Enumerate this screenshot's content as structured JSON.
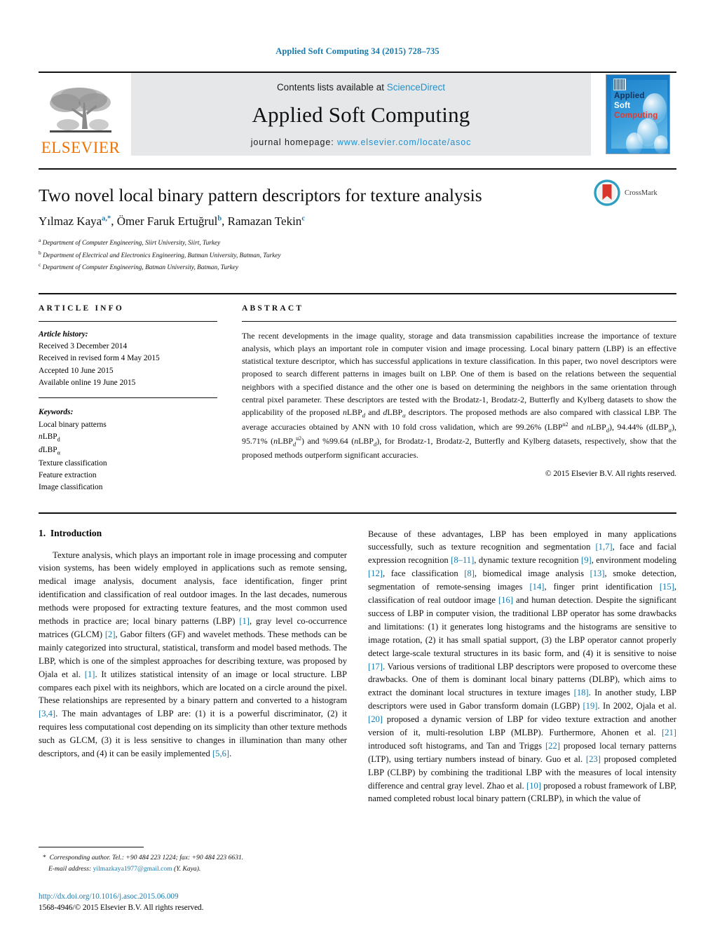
{
  "running_head": "Applied Soft Computing 34 (2015) 728–735",
  "masthead": {
    "publisher": "ELSEVIER",
    "contents_prefix": "Contents lists available at ",
    "contents_link": "ScienceDirect",
    "journal_name": "Applied Soft Computing",
    "homepage_prefix": "journal homepage: ",
    "homepage_url": "www.elsevier.com/locate/asoc",
    "cover": {
      "line1": "Applied",
      "line2": "Soft",
      "line3": "Computing"
    }
  },
  "title": "Two novel local binary pattern descriptors for texture analysis",
  "authors": [
    {
      "name": "Yılmaz Kaya",
      "marks": "a,*"
    },
    {
      "name": "Ömer Faruk Ertuğrul",
      "marks": "b"
    },
    {
      "name": "Ramazan Tekin",
      "marks": "c"
    }
  ],
  "affiliations": [
    {
      "mark": "a",
      "text": "Department of Computer Engineering, Siirt University, Siirt, Turkey"
    },
    {
      "mark": "b",
      "text": "Department of Electrical and Electronics Engineering, Batman University, Batman, Turkey"
    },
    {
      "mark": "c",
      "text": "Department of Computer Engineering, Batman University, Batman, Turkey"
    }
  ],
  "crossmark_label": "CrossMark",
  "article_info": {
    "heading": "ARTICLE INFO",
    "history_title": "Article history:",
    "history": [
      "Received 3 December 2014",
      "Received in revised form 4 May 2015",
      "Accepted 10 June 2015",
      "Available online 19 June 2015"
    ],
    "keywords_title": "Keywords:",
    "keywords": [
      "Local binary patterns",
      "nLBPd",
      "dLBPα",
      "Texture classification",
      "Feature extraction",
      "Image classification"
    ]
  },
  "abstract": {
    "heading": "ABSTRACT",
    "text": "The recent developments in the image quality, storage and data transmission capabilities increase the importance of texture analysis, which plays an important role in computer vision and image processing. Local binary pattern (LBP) is an effective statistical texture descriptor, which has successful applications in texture classification. In this paper, two novel descriptors were proposed to search different patterns in images built on LBP. One of them is based on the relations between the sequential neighbors with a specified distance and the other one is based on determining the neighbors in the same orientation through central pixel parameter. These descriptors are tested with the Brodatz-1, Brodatz-2, Butterfly and Kylberg datasets to show the applicability of the proposed nLBPd and dLBPα descriptors. The proposed methods are also compared with classical LBP. The average accuracies obtained by ANN with 10 fold cross validation, which are 99.26% (LBPu2 and nLBPd), 94.44% (dLBPα), 95.71% (nLBPdu2) and %99.64 (nLBPd), for Brodatz-1, Brodatz-2, Butterfly and Kylberg datasets, respectively, show that the proposed methods outperform significant accuracies.",
    "copyright": "© 2015 Elsevier B.V. All rights reserved."
  },
  "introduction": {
    "section_number": "1.",
    "section_title": "Introduction",
    "left_p1": "Texture analysis, which plays an important role in image processing and computer vision systems, has been widely employed in applications such as remote sensing, medical image analysis, document analysis, face identification, finger print identification and classification of real outdoor images. In the last decades, numerous methods were proposed for extracting texture features, and the most common used methods in practice are; local binary patterns (LBP) [1], gray level co-occurrence matrices (GLCM) [2], Gabor filters (GF) and wavelet methods. These methods can be mainly categorized into structural, statistical, transform and model based methods. The LBP, which is one of the simplest approaches for describing texture, was proposed by Ojala et al. [1]. It utilizes statistical intensity of an image or local structure. LBP compares each pixel with its neighbors, which are located on a circle around the pixel. These relationships are represented by a binary pattern and converted to a histogram [3,4]. The main advantages of LBP are: (1) it is a powerful discriminator, (2) it requires less computational cost depending on its simplicity than other texture methods such as GLCM, (3) it is less sensitive to changes in illumination than many other descriptors, and (4) it can be easily implemented [5,6].",
    "right_p1": "Because of these advantages, LBP has been employed in many applications successfully, such as texture recognition and segmentation [1,7], face and facial expression recognition [8–11], dynamic texture recognition [9], environment modeling [12], face classification [8], biomedical image analysis [13], smoke detection, segmentation of remote-sensing images [14], finger print identification [15], classification of real outdoor image [16] and human detection. Despite the significant success of LBP in computer vision, the traditional LBP operator has some drawbacks and limitations: (1) it generates long histograms and the histograms are sensitive to image rotation, (2) it has small spatial support, (3) the LBP operator cannot properly detect large-scale textural structures in its basic form, and (4) it is sensitive to noise [17]. Various versions of traditional LBP descriptors were proposed to overcome these drawbacks. One of them is dominant local binary patterns (DLBP), which aims to extract the dominant local structures in texture images [18]. In another study, LBP descriptors were used in Gabor transform domain (LGBP) [19]. In 2002, Ojala et al. [20] proposed a dynamic version of LBP for video texture extraction and another version of it, multi-resolution LBP (MLBP). Furthermore, Ahonen et al. [21] introduced soft histograms, and Tan and Triggs [22] proposed local ternary patterns (LTP), using tertiary numbers instead of binary. Guo et al. [23] proposed completed LBP (CLBP) by combining the traditional LBP with the measures of local intensity difference and central gray level. Zhao et al. [10] proposed a robust framework of LBP, named completed robust local binary pattern (CRLBP), in which the value of"
  },
  "footnote": {
    "star": "*",
    "corresponding": "Corresponding author. Tel.: +90 484 223 1224; fax: +90 484 223 6631.",
    "email_label": "E-mail address:",
    "email": "yilmazkaya1977@gmail.com",
    "email_owner": "(Y. Kaya)."
  },
  "footer": {
    "doi": "http://dx.doi.org/10.1016/j.asoc.2015.06.009",
    "issn_line": "1568-4946/© 2015 Elsevier B.V. All rights reserved."
  },
  "colors": {
    "link_blue": "#1a7aad",
    "sciencedirect_blue": "#2291cf",
    "elsevier_orange": "#ee7202",
    "band_gray": "#e6e7e8"
  }
}
